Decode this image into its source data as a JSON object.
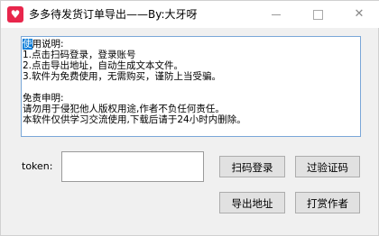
{
  "window": {
    "title": "多多待发货订单导出——By:大牙呀",
    "icon": "pinduoduo-heart-icon",
    "icon_glyph": "♥",
    "controls": {
      "minimize": "minimize",
      "maximize": "maximize",
      "close": "✕"
    }
  },
  "info": {
    "lines": [
      "使用说明:",
      "1.点击扫码登录，登录账号",
      "2.点击导出地址，自动生成文本文件。",
      "3.软件为免费使用，无需购买，谨防上当受骗。",
      "",
      "免责申明:",
      "请勿用于侵犯他人版权用途,作者不负任何责任。",
      "本软件仅供学习交流使用,下载后请于24小时内删除。"
    ],
    "selected_first_char": "使"
  },
  "token": {
    "label": "token:",
    "value": ""
  },
  "buttons": {
    "scan_login": "扫码登录",
    "filter_cert": "过验证码",
    "export_address": "导出地址",
    "reward_author": "打赏作者"
  },
  "colors": {
    "brand": "#e8264c",
    "selection": "#0078d7",
    "textarea_border": "#7aa7d8"
  }
}
